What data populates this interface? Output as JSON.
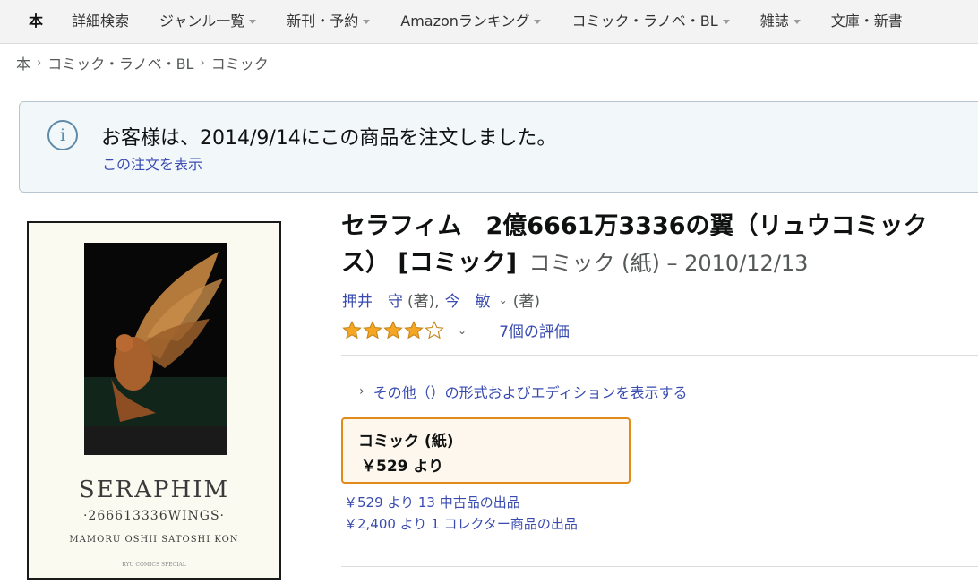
{
  "nav": {
    "items": [
      {
        "label": "本",
        "active": true,
        "caret": false
      },
      {
        "label": "詳細検索",
        "active": false,
        "caret": false
      },
      {
        "label": "ジャンル一覧",
        "active": false,
        "caret": true
      },
      {
        "label": "新刊・予約",
        "active": false,
        "caret": true
      },
      {
        "label": "Amazonランキング",
        "active": false,
        "caret": true
      },
      {
        "label": "コミック・ラノベ・BL",
        "active": false,
        "caret": true
      },
      {
        "label": "雑誌",
        "active": false,
        "caret": true
      },
      {
        "label": "文庫・新書",
        "active": false,
        "caret": false
      }
    ]
  },
  "breadcrumb": {
    "items": [
      "本",
      "コミック・ラノベ・BL",
      "コミック"
    ],
    "separator": "›"
  },
  "notice": {
    "icon": "info-icon",
    "message": "お客様は、2014/9/14にこの商品を注文しました。",
    "link": "この注文を表示"
  },
  "cover": {
    "title": "SERAPHIM",
    "subtitle": "·266613336WINGS·",
    "authors": "MAMORU OSHII   SATOSHI KON",
    "imprint": "RYU COMICS SPECIAL"
  },
  "product": {
    "title": "セラフィム　2億6661万3336の翼（リュウコミックス） [コミック]",
    "format_date": "コミック (紙) – 2010/12/13",
    "author1": "押井　守",
    "author1_role": "(著),",
    "author2": "今　敏",
    "author2_role": "(著)",
    "rating_stars": 4,
    "rating_max": 5,
    "rating_count": "7個の評価",
    "other_formats": "その他（）の形式およびエディションを表示する",
    "format_name": "コミック (紙)",
    "format_price": "￥529 より",
    "offer1_price": "￥529 より",
    "offer1_link": "13 中古品の出品",
    "offer2_price": "￥2,400 より",
    "offer2_link": "1 コレクター商品の出品"
  },
  "colors": {
    "link": "#3a4bb0",
    "star": "#f5a623",
    "format_border": "#e08a1a",
    "notice_bg": "#f2f7fa"
  }
}
